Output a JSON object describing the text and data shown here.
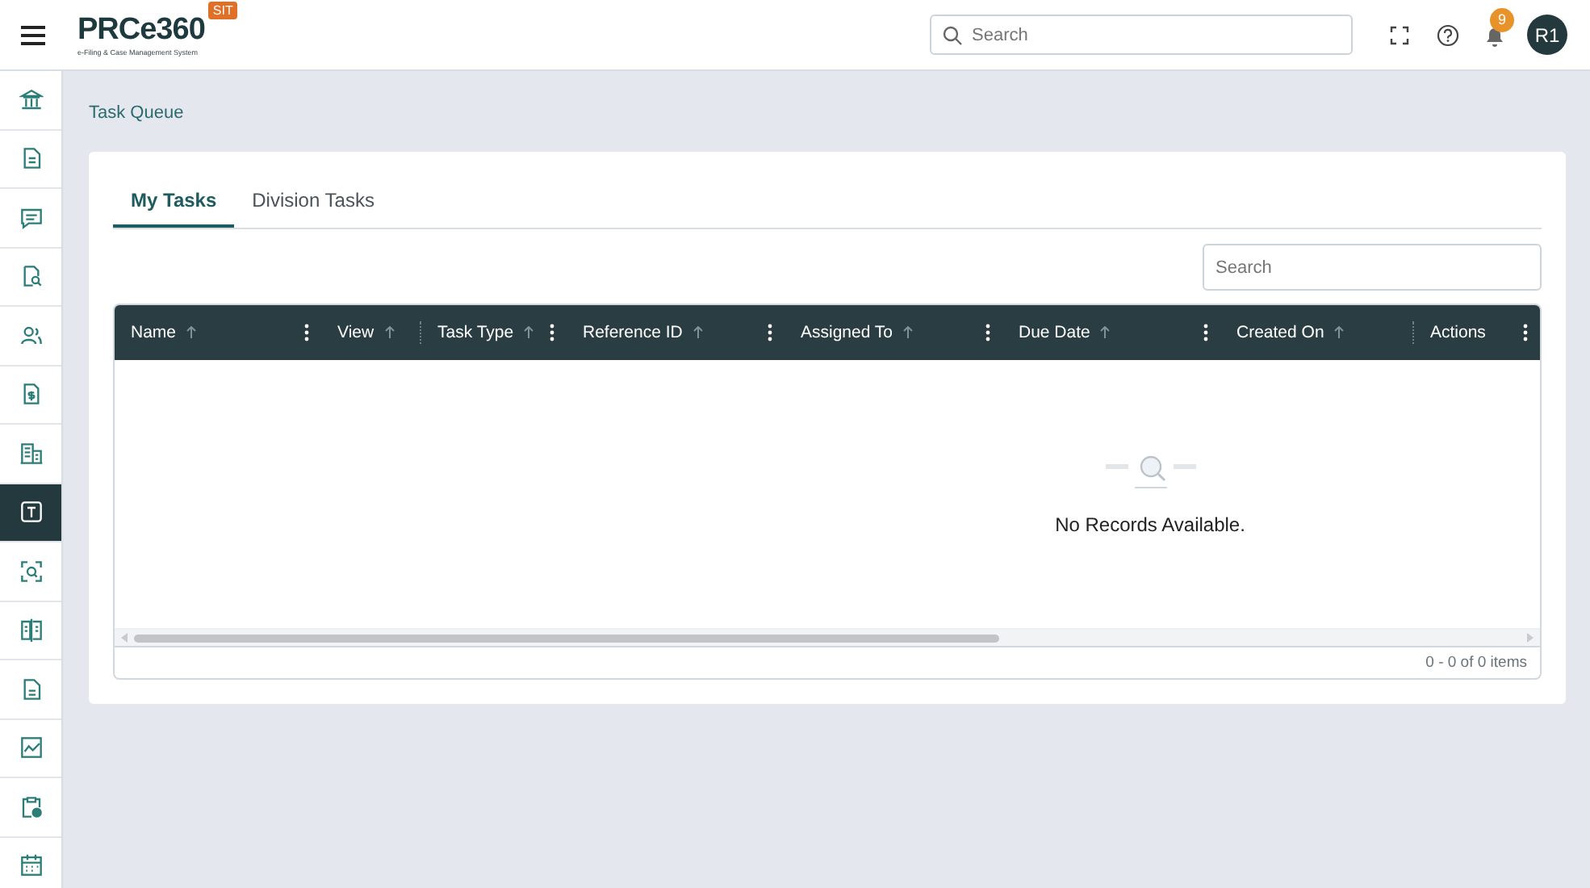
{
  "header": {
    "logo": "PRCe360",
    "logo_subtitle": "e-Filing & Case Management System",
    "env_badge": "SIT",
    "search": {
      "placeholder": "Search"
    },
    "notification_count": "9",
    "avatar": "R1"
  },
  "sidebar": {
    "items": [
      {
        "selected": false
      },
      {
        "selected": false
      },
      {
        "selected": false
      },
      {
        "selected": false
      },
      {
        "selected": false
      },
      {
        "selected": false
      },
      {
        "selected": false
      },
      {
        "selected": true
      },
      {
        "selected": false
      },
      {
        "selected": false
      },
      {
        "selected": false
      },
      {
        "selected": false
      },
      {
        "selected": false
      },
      {
        "selected": false
      }
    ]
  },
  "breadcrumb": "Task Queue",
  "tabs": [
    {
      "label": "My Tasks",
      "selected": true
    },
    {
      "label": "Division Tasks",
      "selected": false
    }
  ],
  "grid_search": {
    "placeholder": "Search"
  },
  "table": {
    "columns": [
      {
        "label": "Name",
        "sortable": true,
        "menu": true
      },
      {
        "label": "View",
        "sortable": true,
        "menu": false
      },
      {
        "label": "Task Type",
        "sortable": true,
        "menu": true
      },
      {
        "label": "Reference ID",
        "sortable": true,
        "menu": true
      },
      {
        "label": "Assigned To",
        "sortable": true,
        "menu": true
      },
      {
        "label": "Due Date",
        "sortable": true,
        "menu": true
      },
      {
        "label": "Created On",
        "sortable": true,
        "menu": false
      },
      {
        "label": "Actions",
        "sortable": false,
        "menu": true
      }
    ],
    "empty_message": "No Records Available.",
    "pager": "0 - 0 of 0 items"
  }
}
